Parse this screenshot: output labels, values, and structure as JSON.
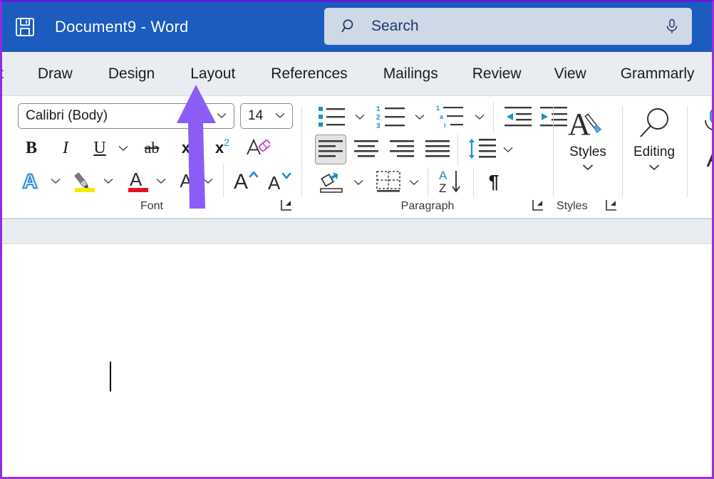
{
  "titlebar": {
    "save_icon": "save-icon",
    "document_title": "Document9  -  Word",
    "accent_color": "#1b5cbe"
  },
  "search": {
    "icon": "search-icon",
    "placeholder": "Search",
    "value": "",
    "mic_icon": "microphone-icon"
  },
  "tabs": [
    {
      "label": "t",
      "name": "tab-insert-cut",
      "active": false
    },
    {
      "label": "Draw",
      "name": "tab-draw",
      "active": false
    },
    {
      "label": "Design",
      "name": "tab-design",
      "active": false
    },
    {
      "label": "Layout",
      "name": "tab-layout",
      "active": false
    },
    {
      "label": "References",
      "name": "tab-references",
      "active": false
    },
    {
      "label": "Mailings",
      "name": "tab-mailings",
      "active": false
    },
    {
      "label": "Review",
      "name": "tab-review",
      "active": false
    },
    {
      "label": "View",
      "name": "tab-view",
      "active": false
    },
    {
      "label": "Grammarly",
      "name": "tab-grammarly",
      "active": false
    }
  ],
  "ribbon": {
    "font_group": {
      "label": "Font",
      "font_name": "Calibri (Body)",
      "font_size": "14",
      "buttons": {
        "bold": "B",
        "italic": "I",
        "underline": "U",
        "strikethrough": "ab",
        "subscript": "x",
        "superscript": "x",
        "superscript_sup": "2",
        "clear_formatting": "A",
        "text_effects": "A",
        "highlight": "highlighter-icon",
        "font_color": "A",
        "text_shading": "A",
        "grow_font": "A",
        "shrink_font": "A"
      },
      "dialog_launcher": "font-dialog-launcher"
    },
    "paragraph_group": {
      "label": "Paragraph",
      "buttons": {
        "bullets": "bullet-list-icon",
        "numbering": "numbered-list-icon",
        "multilevel": "multilevel-list-icon",
        "decrease_indent": "decrease-indent-icon",
        "increase_indent": "increase-indent-icon",
        "align_left": "align-left-icon",
        "align_center": "align-center-icon",
        "align_right": "align-right-icon",
        "justify": "justify-icon",
        "line_spacing": "line-spacing-icon",
        "shading": "shading-icon",
        "borders": "borders-icon",
        "sort": "sort-icon",
        "show_marks": "¶"
      },
      "numbering_digits": [
        "1",
        "2",
        "3"
      ],
      "multilevel_marks": [
        "1",
        "a",
        "i"
      ],
      "selected_alignment": "align_left",
      "dialog_launcher": "paragraph-dialog-launcher"
    },
    "styles_group": {
      "label": "Styles",
      "button_label": "Styles",
      "icon": "styles-brush-icon",
      "dialog_launcher": "styles-dialog-launcher"
    },
    "editing_group": {
      "button_label": "Editing",
      "icon": "magnifier-icon"
    },
    "voice_group": {
      "icon": "microphone-icon",
      "editor_icon": "A"
    }
  },
  "document": {
    "caret": "text-cursor",
    "body_text": ""
  },
  "annotation": {
    "arrow": "purple-up-arrow",
    "arrow_color": "#8b5cf6",
    "points_to": "Layout"
  }
}
